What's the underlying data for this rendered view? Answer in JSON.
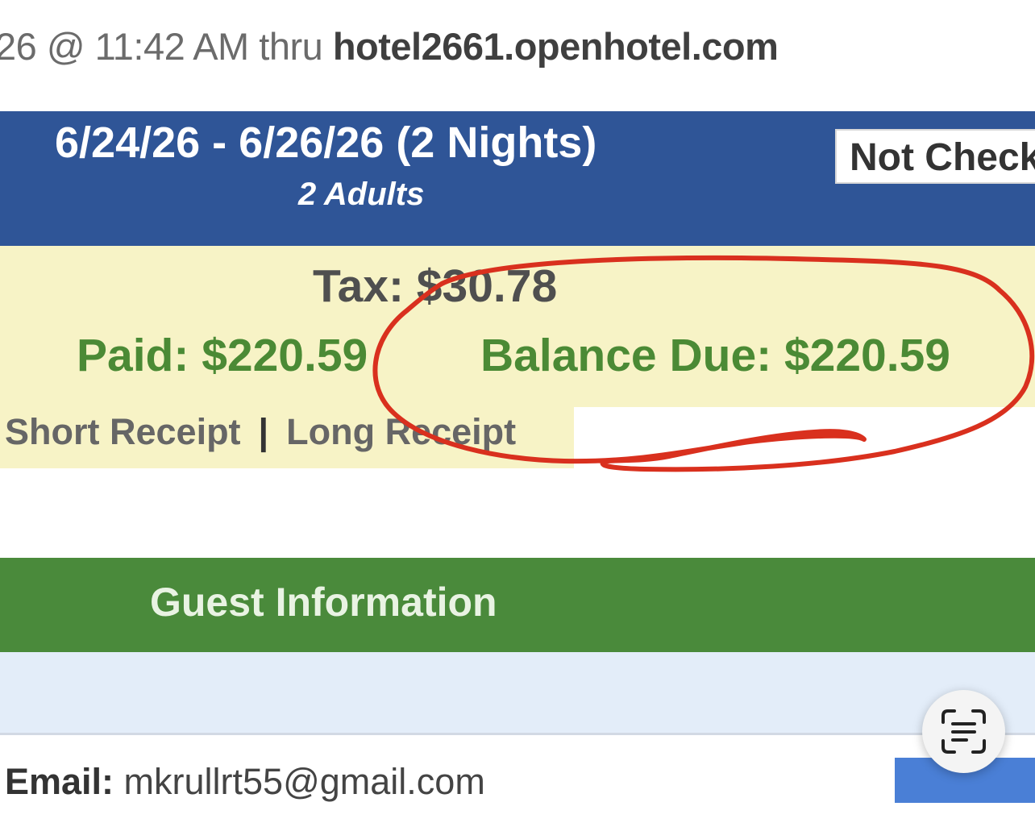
{
  "booking": {
    "date_fragment": "26 @ 11:42 AM thru ",
    "host": "hotel2661.openhotel.com"
  },
  "reservation": {
    "dates": "6/24/26 - 6/26/26 (2 Nights)",
    "guests": "2 Adults",
    "status": "Not Checked In"
  },
  "totals": {
    "tax": "Tax: $30.78",
    "paid": "Paid: $220.59",
    "balance_due": "Balance Due: $220.59"
  },
  "receipts": {
    "short": "Short Receipt",
    "separator": "|",
    "long": "Long Receipt"
  },
  "guest_section": {
    "title": "Guest Information",
    "email_label": "Email:",
    "email_value": " mkrullrt55@gmail.com"
  },
  "annotation": {
    "color": "#d9301e"
  },
  "colors": {
    "header_blue": "#2f5597",
    "totals_yellow": "#f7f3c6",
    "section_green": "#4a8a3b",
    "money_green": "#4b8a35"
  },
  "icons": {
    "live_text": "text-scan-icon"
  }
}
